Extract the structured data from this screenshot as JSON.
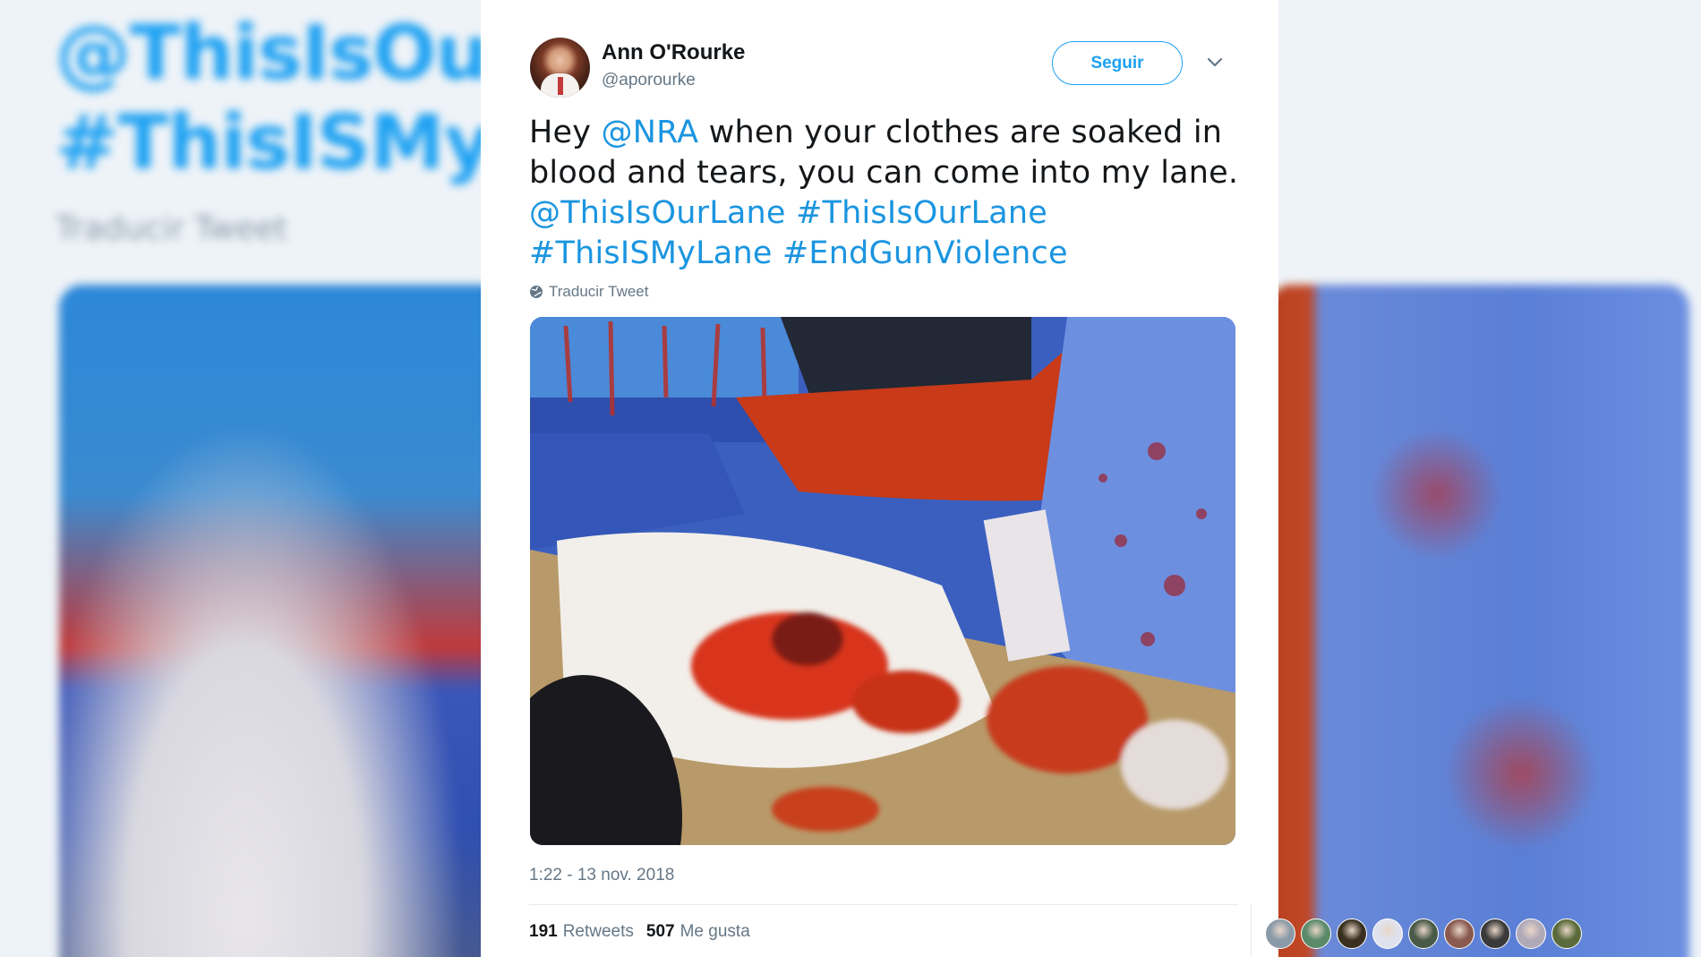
{
  "background": {
    "line1": "@ThisIsOurL",
    "line2": "#ThisISMyLa",
    "translate": "Traducir Tweet"
  },
  "tweet": {
    "author_name": "Ann O'Rourke",
    "author_handle": "@aporourke",
    "follow_label": "Seguir",
    "text_lines": [
      [
        {
          "t": "Hey "
        },
        {
          "t": "@NRA",
          "link": true
        },
        {
          "t": " when your clothes are soaked in"
        }
      ],
      [
        {
          "t": "blood and tears, you can come into my lane."
        }
      ],
      [
        {
          "t": "@ThisIsOurLane",
          "link": true
        },
        {
          "t": " "
        },
        {
          "t": "#ThisIsOurLane",
          "link": true
        }
      ],
      [
        {
          "t": "#ThisISMyLane",
          "link": true
        },
        {
          "t": "  "
        },
        {
          "t": "#EndGunViolence",
          "link": true
        }
      ]
    ],
    "translate_label": "Traducir Tweet",
    "photo_description": "blood-soaked-surgical-drapes-photo",
    "timestamp": "1:22 - 13 nov. 2018",
    "retweets_count": "191",
    "retweets_label": "Retweets",
    "likes_count": "507",
    "likes_label": "Me gusta",
    "likers": [
      "#8a9aa8",
      "#5a8a6a",
      "#3a3020",
      "#dfe2ee",
      "#4a5a48",
      "#8a5a50",
      "#3a3a3a",
      "#b0aab8",
      "#5a6a3a"
    ]
  },
  "colors": {
    "accent": "#1da1f2",
    "link": "#1b95e0",
    "text": "#14171a",
    "muted": "#657786"
  }
}
